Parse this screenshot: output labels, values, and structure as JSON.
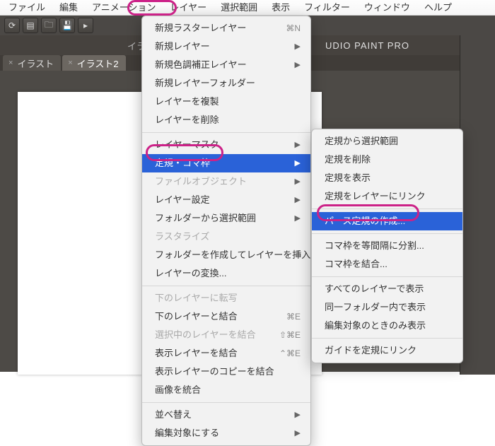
{
  "menubar": {
    "items": [
      "ファイル",
      "編集",
      "アニメーション",
      "レイヤー",
      "選択範囲",
      "表示",
      "フィルター",
      "ウィンドウ",
      "ヘルプ"
    ],
    "active": "レイヤー"
  },
  "app_title_fragment": "UDIO PAINT PRO",
  "document_title_fragment": "イラ",
  "tabs": [
    {
      "label": "イラスト",
      "active": false,
      "close": "×"
    },
    {
      "label": "イラスト2",
      "active": true,
      "close": "×"
    }
  ],
  "main_menu": [
    {
      "type": "item",
      "label": "新規ラスターレイヤー",
      "shortcut": "⌘N"
    },
    {
      "type": "item",
      "label": "新規レイヤー",
      "arrow": true
    },
    {
      "type": "item",
      "label": "新規色調補正レイヤー",
      "arrow": true
    },
    {
      "type": "item",
      "label": "新規レイヤーフォルダー"
    },
    {
      "type": "item",
      "label": "レイヤーを複製"
    },
    {
      "type": "item",
      "label": "レイヤーを削除"
    },
    {
      "type": "sep"
    },
    {
      "type": "item",
      "label": "レイヤーマスク",
      "arrow": true
    },
    {
      "type": "item",
      "label": "定規・コマ枠",
      "arrow": true,
      "selected": true
    },
    {
      "type": "item",
      "label": "ファイルオブジェクト",
      "arrow": true,
      "disabled": true
    },
    {
      "type": "item",
      "label": "レイヤー設定",
      "arrow": true
    },
    {
      "type": "item",
      "label": "フォルダーから選択範囲",
      "arrow": true
    },
    {
      "type": "item",
      "label": "ラスタライズ",
      "disabled": true
    },
    {
      "type": "item",
      "label": "フォルダーを作成してレイヤーを挿入"
    },
    {
      "type": "item",
      "label": "レイヤーの変換..."
    },
    {
      "type": "sep"
    },
    {
      "type": "item",
      "label": "下のレイヤーに転写",
      "disabled": true
    },
    {
      "type": "item",
      "label": "下のレイヤーと結合",
      "shortcut": "⌘E"
    },
    {
      "type": "item",
      "label": "選択中のレイヤーを結合",
      "shortcut": "⇧⌘E",
      "disabled": true
    },
    {
      "type": "item",
      "label": "表示レイヤーを結合",
      "shortcut": "⌃⌘E"
    },
    {
      "type": "item",
      "label": "表示レイヤーのコピーを結合"
    },
    {
      "type": "item",
      "label": "画像を統合"
    },
    {
      "type": "sep"
    },
    {
      "type": "item",
      "label": "並べ替え",
      "arrow": true
    },
    {
      "type": "item",
      "label": "編集対象にする",
      "arrow": true
    }
  ],
  "sub_menu": [
    {
      "type": "item",
      "label": "定規から選択範囲"
    },
    {
      "type": "item",
      "label": "定規を削除"
    },
    {
      "type": "item",
      "label": "定規を表示"
    },
    {
      "type": "item",
      "label": "定規をレイヤーにリンク"
    },
    {
      "type": "sep"
    },
    {
      "type": "item",
      "label": "パース定規の作成...",
      "selected": true
    },
    {
      "type": "sep"
    },
    {
      "type": "item",
      "label": "コマ枠を等間隔に分割..."
    },
    {
      "type": "item",
      "label": "コマ枠を結合..."
    },
    {
      "type": "sep"
    },
    {
      "type": "item",
      "label": "すべてのレイヤーで表示"
    },
    {
      "type": "item",
      "label": "同一フォルダー内で表示"
    },
    {
      "type": "item",
      "label": "編集対象のときのみ表示"
    },
    {
      "type": "sep"
    },
    {
      "type": "item",
      "label": "ガイドを定規にリンク"
    }
  ]
}
